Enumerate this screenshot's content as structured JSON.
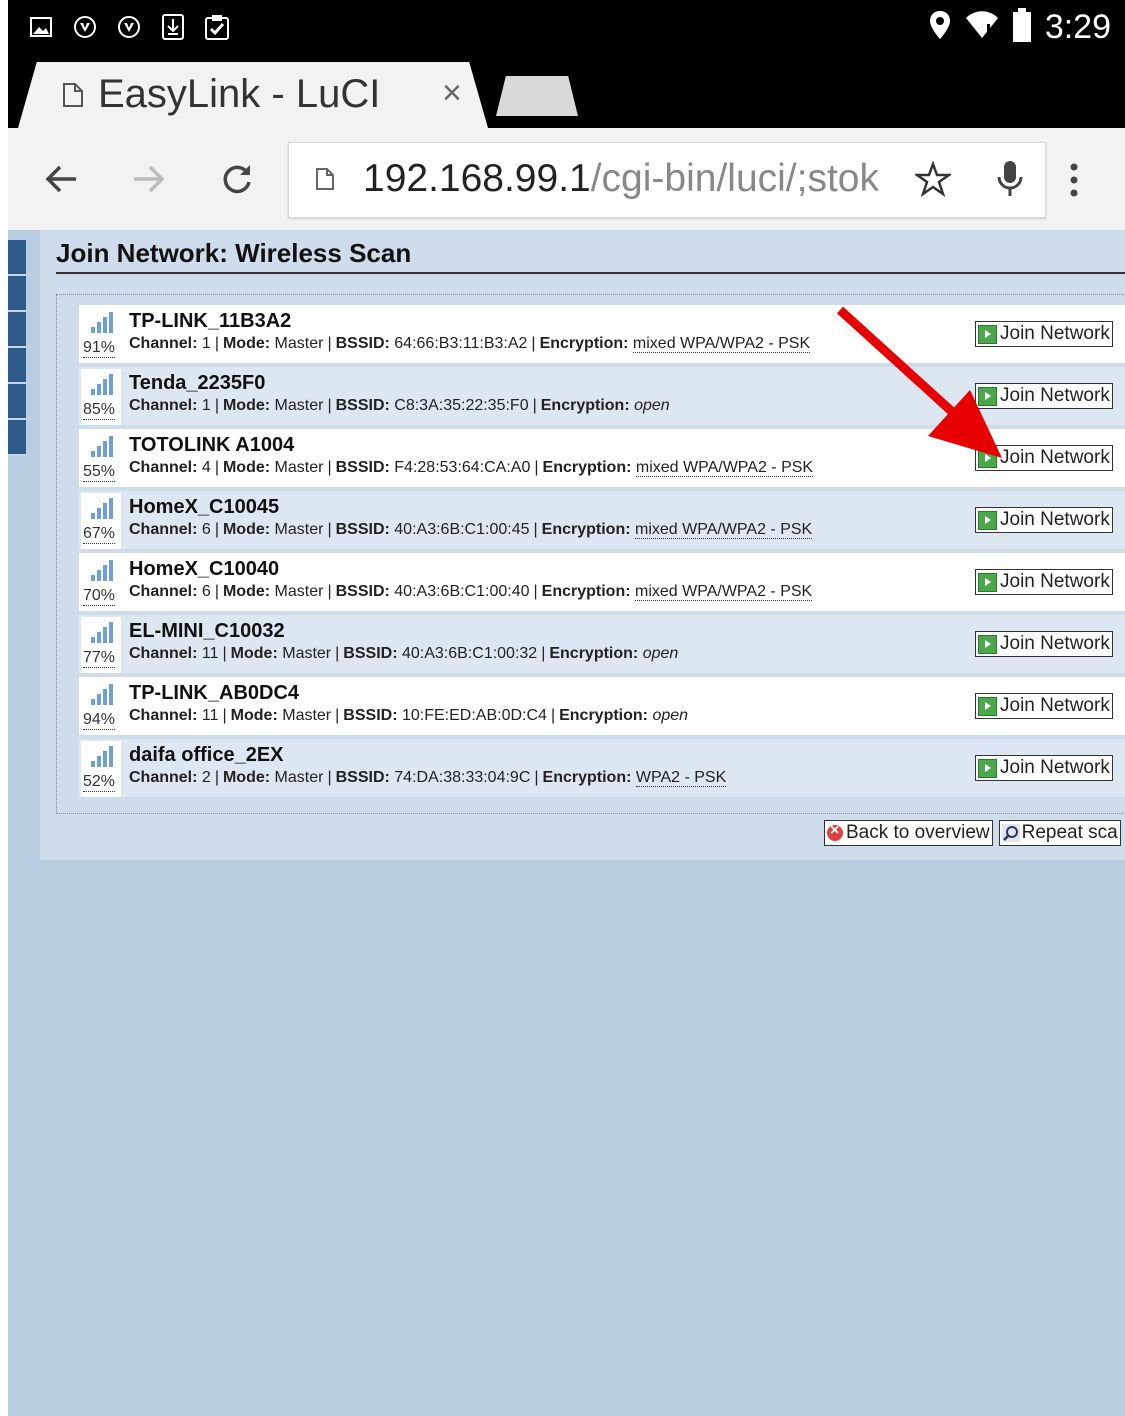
{
  "status_bar": {
    "time": "3:29",
    "left_icons": [
      "image-icon",
      "shield-icon",
      "shield-icon",
      "download-icon",
      "clipboard-check-icon"
    ],
    "right_icons": [
      "location-icon",
      "wifi-icon",
      "battery-icon"
    ]
  },
  "browser": {
    "tab_title": "EasyLink - LuCI",
    "tab_close": "×",
    "url_host": "192.168.99.1",
    "url_path": "/cgi-bin/luci/;stok"
  },
  "page": {
    "heading": "Join Network: Wireless Scan",
    "labels": {
      "channel": "Channel:",
      "mode": "Mode:",
      "bssid": "BSSID:",
      "encryption": "Encryption:",
      "separator": "|"
    },
    "join_label": "Join Network",
    "networks": [
      {
        "ssid": "TP-LINK_11B3A2",
        "signal": "91%",
        "channel": "1",
        "mode": "Master",
        "bssid": "64:66:B3:11:B3:A2",
        "encryption": "mixed WPA/WPA2 - PSK"
      },
      {
        "ssid": "Tenda_2235F0",
        "signal": "85%",
        "channel": "1",
        "mode": "Master",
        "bssid": "C8:3A:35:22:35:F0",
        "encryption": "open"
      },
      {
        "ssid": "TOTOLINK A1004",
        "signal": "55%",
        "channel": "4",
        "mode": "Master",
        "bssid": "F4:28:53:64:CA:A0",
        "encryption": "mixed WPA/WPA2 - PSK"
      },
      {
        "ssid": "HomeX_C10045",
        "signal": "67%",
        "channel": "6",
        "mode": "Master",
        "bssid": "40:A3:6B:C1:00:45",
        "encryption": "mixed WPA/WPA2 - PSK"
      },
      {
        "ssid": "HomeX_C10040",
        "signal": "70%",
        "channel": "6",
        "mode": "Master",
        "bssid": "40:A3:6B:C1:00:40",
        "encryption": "mixed WPA/WPA2 - PSK"
      },
      {
        "ssid": "EL-MINI_C10032",
        "signal": "77%",
        "channel": "11",
        "mode": "Master",
        "bssid": "40:A3:6B:C1:00:32",
        "encryption": "open"
      },
      {
        "ssid": "TP-LINK_AB0DC4",
        "signal": "94%",
        "channel": "11",
        "mode": "Master",
        "bssid": "10:FE:ED:AB:0D:C4",
        "encryption": "open"
      },
      {
        "ssid": "daifa office_2EX",
        "signal": "52%",
        "channel": "2",
        "mode": "Master",
        "bssid": "74:DA:38:33:04:9C",
        "encryption": "WPA2 - PSK"
      }
    ],
    "back_button": "Back to overview",
    "repeat_button": "Repeat sca"
  },
  "colors": {
    "annotation_arrow": "#e60000",
    "page_background": "#b8cde0",
    "nav_accent": "#2d5a88"
  }
}
